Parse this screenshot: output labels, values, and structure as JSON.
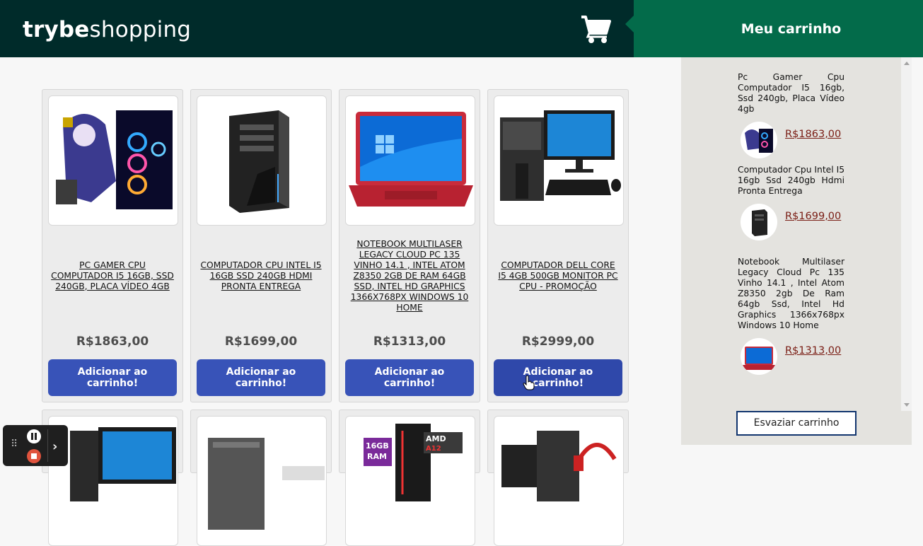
{
  "header": {
    "logo_bold": "trybe",
    "logo_light": "shopping",
    "cart_icon": "shopping-cart-icon"
  },
  "cart": {
    "title": "Meu carrinho",
    "items": [
      {
        "title": "Pc Gamer Cpu Computador I5 16gb, Ssd 240gb, Placa Vídeo 4gb",
        "price": "R$1863,00"
      },
      {
        "title": "Computador Cpu Intel I5 16gb Ssd 240gb Hdmi Pronta Entrega",
        "price": "R$1699,00"
      },
      {
        "title": "Notebook Multilaser Legacy Cloud Pc 135 Vinho 14.1 , Intel Atom Z8350 2gb De Ram 64gb Ssd, Intel Hd Graphics 1366x768px Windows 10 Home",
        "price": "R$1313,00"
      }
    ],
    "empty_label": "Esvaziar carrinho"
  },
  "products": [
    {
      "title": "PC GAMER CPU COMPUTADOR I5 16GB, SSD 240GB, PLACA VÍDEO 4GB",
      "price": "R$1863,00",
      "button": "Adicionar ao carrinho!"
    },
    {
      "title": "COMPUTADOR CPU INTEL I5 16GB SSD 240GB HDMI PRONTA ENTREGA",
      "price": "R$1699,00",
      "button": "Adicionar ao carrinho!"
    },
    {
      "title": "NOTEBOOK MULTILASER LEGACY CLOUD PC 135 VINHO 14.1 , INTEL ATOM Z8350 2GB DE RAM 64GB SSD, INTEL HD GRAPHICS 1366X768PX WINDOWS 10 HOME",
      "price": "R$1313,00",
      "button": "Adicionar ao carrinho!"
    },
    {
      "title": "COMPUTADOR DELL CORE I5 4GB 500GB MONITOR PC CPU - PROMOÇÃO",
      "price": "R$2999,00",
      "button": "Adicionar ao carrinho!"
    }
  ],
  "colors": {
    "header_bg": "#002b2a",
    "cart_header_bg": "#036b4a",
    "button_bg": "#3853b8",
    "price_link": "#7a1d14"
  }
}
